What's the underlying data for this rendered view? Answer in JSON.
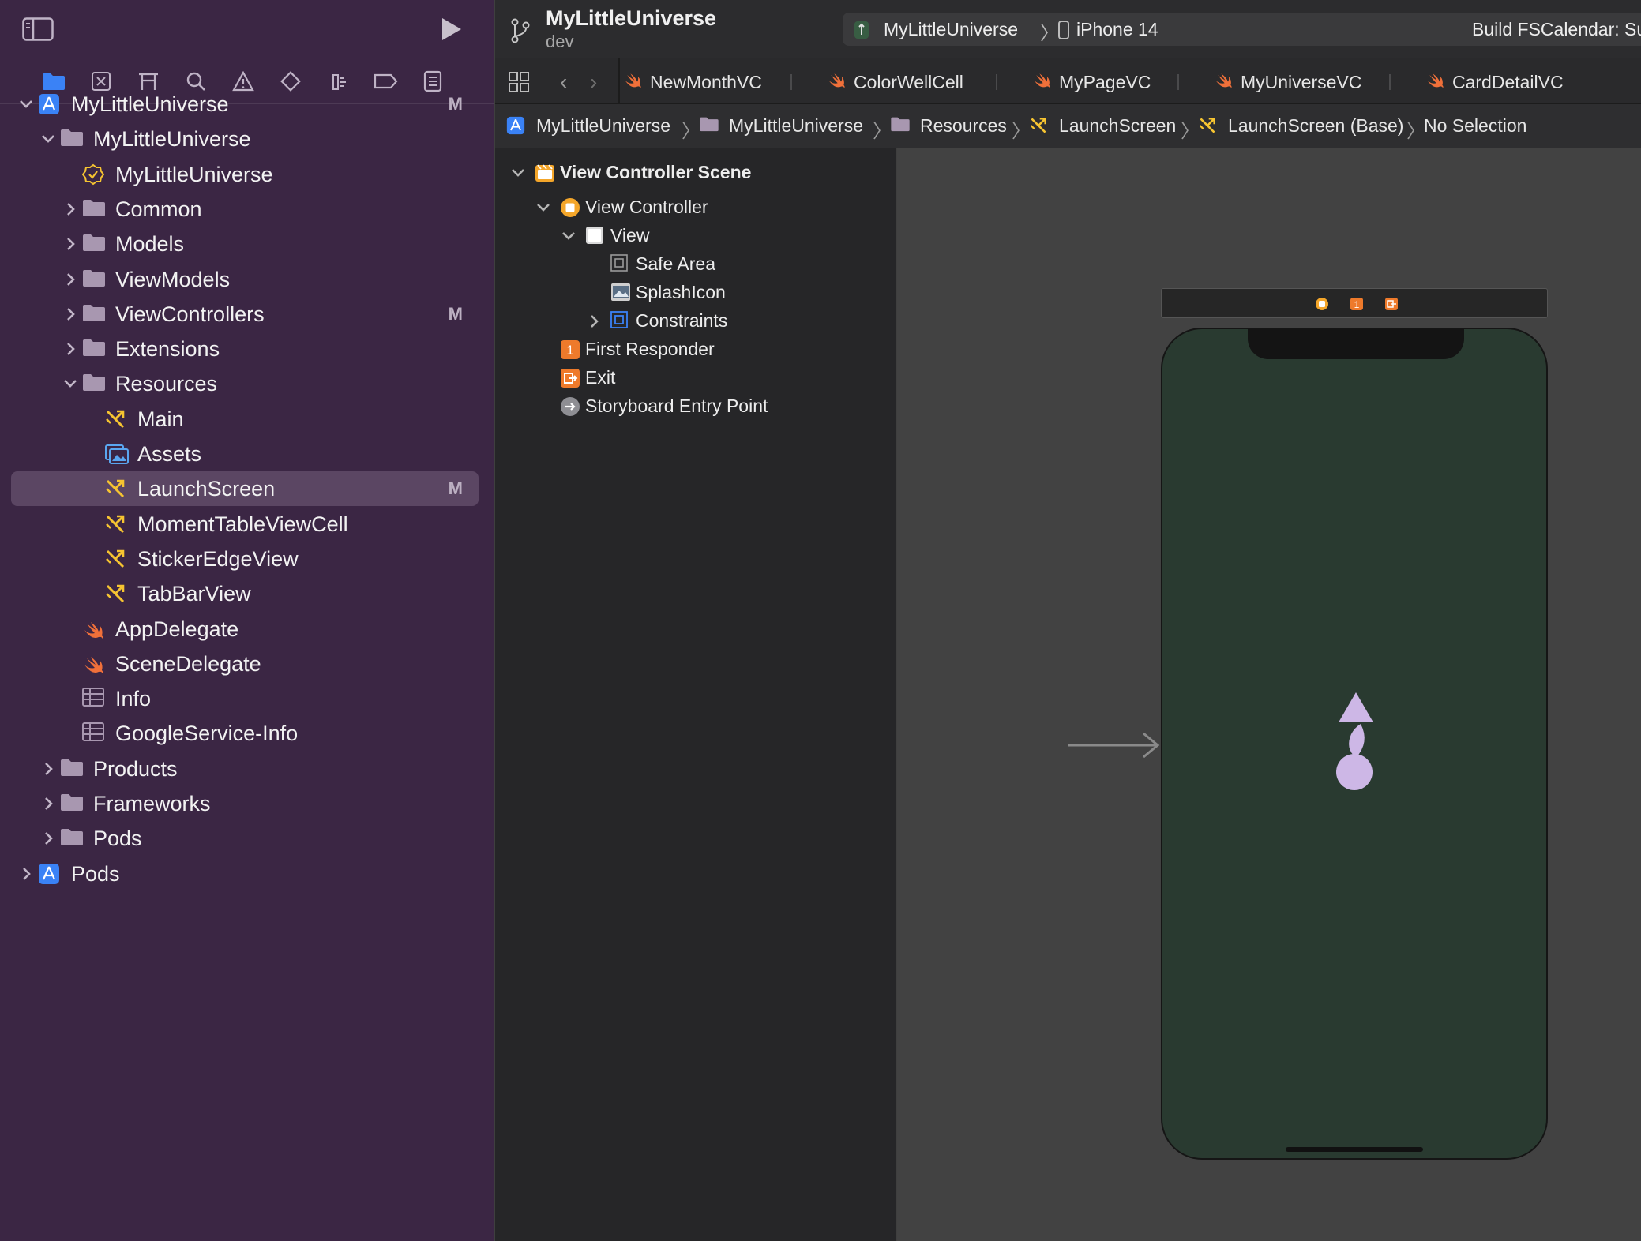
{
  "project": {
    "name": "MyLittleUniverse",
    "branch": "dev"
  },
  "scheme": {
    "target": "MyLittleUniverse",
    "device": "iPhone 14",
    "status": "Build FSCalendar: Su"
  },
  "navigator_tabs": [
    "folder-icon",
    "source-control-icon",
    "symbol-icon",
    "search-icon",
    "warning-icon",
    "test-icon",
    "debug-icon",
    "breakpoint-icon",
    "report-icon"
  ],
  "file_tree": [
    {
      "label": "MyLittleUniverse",
      "badge": "M",
      "icon": "project-icon",
      "expanded": true
    },
    {
      "label": "MyLittleUniverse",
      "badge": "",
      "icon": "folder-icon",
      "expanded": true
    },
    {
      "label": "MyLittleUniverse",
      "badge": "",
      "icon": "entitlements-icon"
    },
    {
      "label": "Common",
      "badge": "",
      "icon": "folder-icon",
      "expanded": false
    },
    {
      "label": "Models",
      "badge": "",
      "icon": "folder-icon",
      "expanded": false
    },
    {
      "label": "ViewModels",
      "badge": "",
      "icon": "folder-icon",
      "expanded": false
    },
    {
      "label": "ViewControllers",
      "badge": "M",
      "icon": "folder-icon",
      "expanded": false
    },
    {
      "label": "Extensions",
      "badge": "",
      "icon": "folder-icon",
      "expanded": false
    },
    {
      "label": "Resources",
      "badge": "",
      "icon": "folder-icon",
      "expanded": true
    },
    {
      "label": "Main",
      "badge": "",
      "icon": "storyboard-icon"
    },
    {
      "label": "Assets",
      "badge": "",
      "icon": "assets-icon"
    },
    {
      "label": "LaunchScreen",
      "badge": "M",
      "icon": "storyboard-icon",
      "selected": true
    },
    {
      "label": "MomentTableViewCell",
      "badge": "",
      "icon": "storyboard-icon"
    },
    {
      "label": "StickerEdgeView",
      "badge": "",
      "icon": "storyboard-icon"
    },
    {
      "label": "TabBarView",
      "badge": "",
      "icon": "storyboard-icon"
    },
    {
      "label": "AppDelegate",
      "badge": "",
      "icon": "swift-icon"
    },
    {
      "label": "SceneDelegate",
      "badge": "",
      "icon": "swift-icon"
    },
    {
      "label": "Info",
      "badge": "",
      "icon": "plist-icon"
    },
    {
      "label": "GoogleService-Info",
      "badge": "",
      "icon": "plist-icon"
    },
    {
      "label": "Products",
      "badge": "",
      "icon": "folder-icon",
      "expanded": false
    },
    {
      "label": "Frameworks",
      "badge": "",
      "icon": "folder-icon",
      "expanded": false
    },
    {
      "label": "Pods",
      "badge": "",
      "icon": "folder-icon",
      "expanded": false
    },
    {
      "label": "Pods",
      "badge": "",
      "icon": "project-icon",
      "expanded": false
    }
  ],
  "editor_tabs": [
    "NewMonthVC",
    "ColorWellCell",
    "MyPageVC",
    "MyUniverseVC",
    "CardDetailVC"
  ],
  "jump_bar": [
    "MyLittleUniverse",
    "MyLittleUniverse",
    "Resources",
    "LaunchScreen",
    "LaunchScreen (Base)",
    "No Selection"
  ],
  "outline": [
    {
      "label": "View Controller Scene",
      "icon": "scene-icon"
    },
    {
      "label": "View Controller",
      "icon": "view-controller-icon"
    },
    {
      "label": "View",
      "icon": "view-icon"
    },
    {
      "label": "Safe Area",
      "icon": "safe-area-icon"
    },
    {
      "label": "SplashIcon",
      "icon": "image-view-icon"
    },
    {
      "label": "Constraints",
      "icon": "constraints-icon"
    },
    {
      "label": "First Responder",
      "icon": "first-responder-icon"
    },
    {
      "label": "Exit",
      "icon": "exit-icon"
    },
    {
      "label": "Storyboard Entry Point",
      "icon": "entry-point-icon"
    }
  ],
  "colors": {
    "sidebar_bg": "#3b2644",
    "selection": "#5b4663",
    "device_screen": "#293a30",
    "splash_icon": "#cdb7e6",
    "swift": "#f0703a",
    "storyboard": "#f6c431",
    "project": "#3a82f6"
  }
}
